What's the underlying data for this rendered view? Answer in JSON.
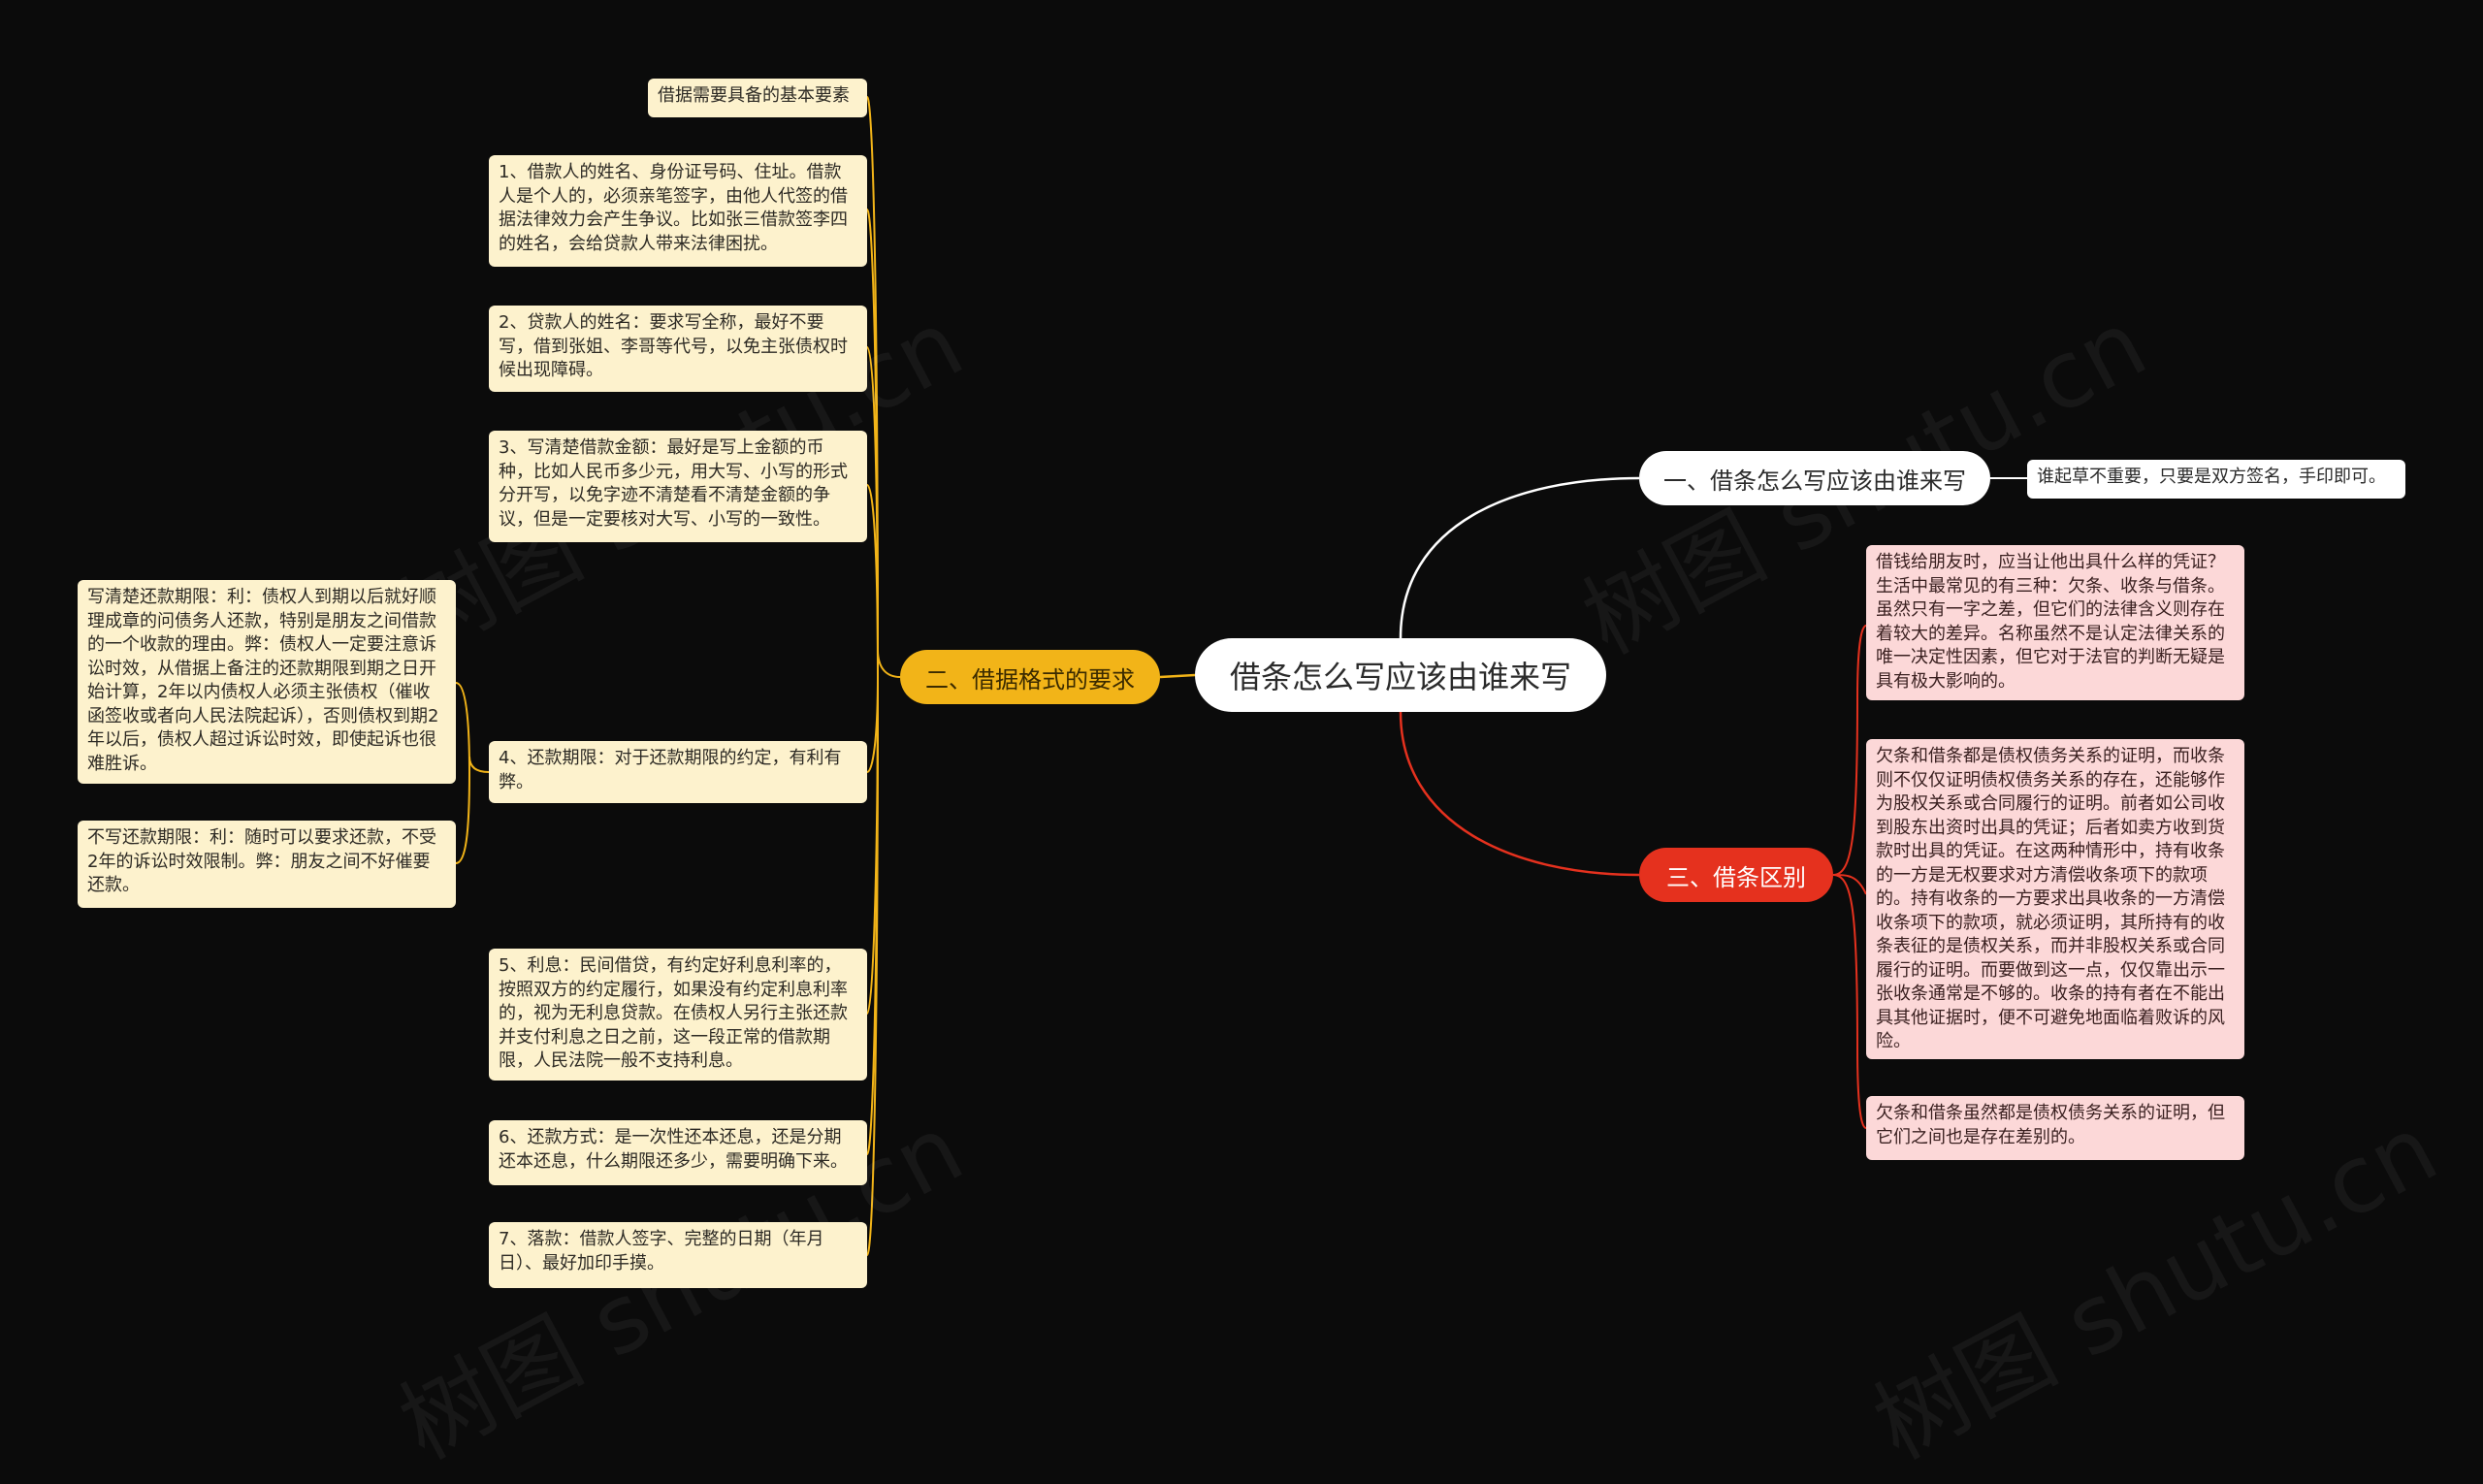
{
  "root": {
    "label": "借条怎么写应该由谁来写"
  },
  "branches": {
    "left": {
      "label": "二、借据格式的要求",
      "items": [
        "借据需要具备的基本要素",
        "1、借款人的姓名、身份证号码、住址。借款人是个人的，必须亲笔签字，由他人代签的借据法律效力会产生争议。比如张三借款签李四的姓名，会给贷款人带来法律困扰。",
        "2、贷款人的姓名：要求写全称，最好不要写，借到张姐、李哥等代号，以免主张债权时候出现障碍。",
        "3、写清楚借款金额：最好是写上金额的币种，比如人民币多少元，用大写、小写的形式分开写，以免字迹不清楚看不清楚金额的争议，但是一定要核对大写、小写的一致性。",
        "4、还款期限：对于还款期限的约定，有利有弊。",
        "5、利息：民间借贷，有约定好利息利率的，按照双方的约定履行，如果没有约定利息利率的，视为无利息贷款。在债权人另行主张还款并支付利息之日之前，这一段正常的借款期限，人民法院一般不支持利息。",
        "6、还款方式：是一次性还本还息，还是分期还本还息，什么期限还多少，需要明确下来。",
        "7、落款：借款人签字、完整的日期（年月日）、最好加印手摸。"
      ],
      "sub_items": [
        "写清楚还款期限：利：债权人到期以后就好顺理成章的问债务人还款，特别是朋友之间借款的一个收款的理由。弊：债权人一定要注意诉讼时效，从借据上备注的还款期限到期之日开始计算，2年以内债权人必须主张债权（催收函签收或者向人民法院起诉），否则债权到期2年以后，债权人超过诉讼时效，即使起诉也很难胜诉。",
        "不写还款期限：利：随时可以要求还款，不受2年的诉讼时效限制。弊：朋友之间不好催要还款。"
      ]
    },
    "right1": {
      "label": "一、借条怎么写应该由谁来写",
      "items": [
        "谁起草不重要，只要是双方签名，手印即可。"
      ]
    },
    "right3": {
      "label": "三、借条区别",
      "items": [
        "借钱给朋友时，应当让他出具什么样的凭证？生活中最常见的有三种：欠条、收条与借条。虽然只有一字之差，但它们的法律含义则存在着较大的差异。名称虽然不是认定法律关系的唯一决定性因素，但它对于法官的判断无疑是具有极大影响的。",
        "欠条和借条都是债权债务关系的证明，而收条则不仅仅证明债权债务关系的存在，还能够作为股权关系或合同履行的证明。前者如公司收到股东出资时出具的凭证；后者如卖方收到货款时出具的凭证。在这两种情形中，持有收条的一方是无权要求对方清偿收条项下的款项的。持有收条的一方要求出具收条的一方清偿收条项下的款项，就必须证明，其所持有的收条表征的是债权关系，而并非股权关系或合同履行的证明。而要做到这一点，仅仅靠出示一张收条通常是不够的。收条的持有者在不能出具其他证据时，便不可避免地面临着败诉的风险。",
        "欠条和借条虽然都是债权债务关系的证明，但它们之间也是存在差别的。"
      ]
    }
  },
  "watermark": "树图 shutu.cn",
  "colors": {
    "background": "#0b0b0b",
    "left_branch": "#f2b418",
    "left_leaf": "#fdf2cd",
    "right3_branch": "#e5311e",
    "right3_leaf": "#fcd8d8",
    "right1_link": "#ffffff"
  }
}
